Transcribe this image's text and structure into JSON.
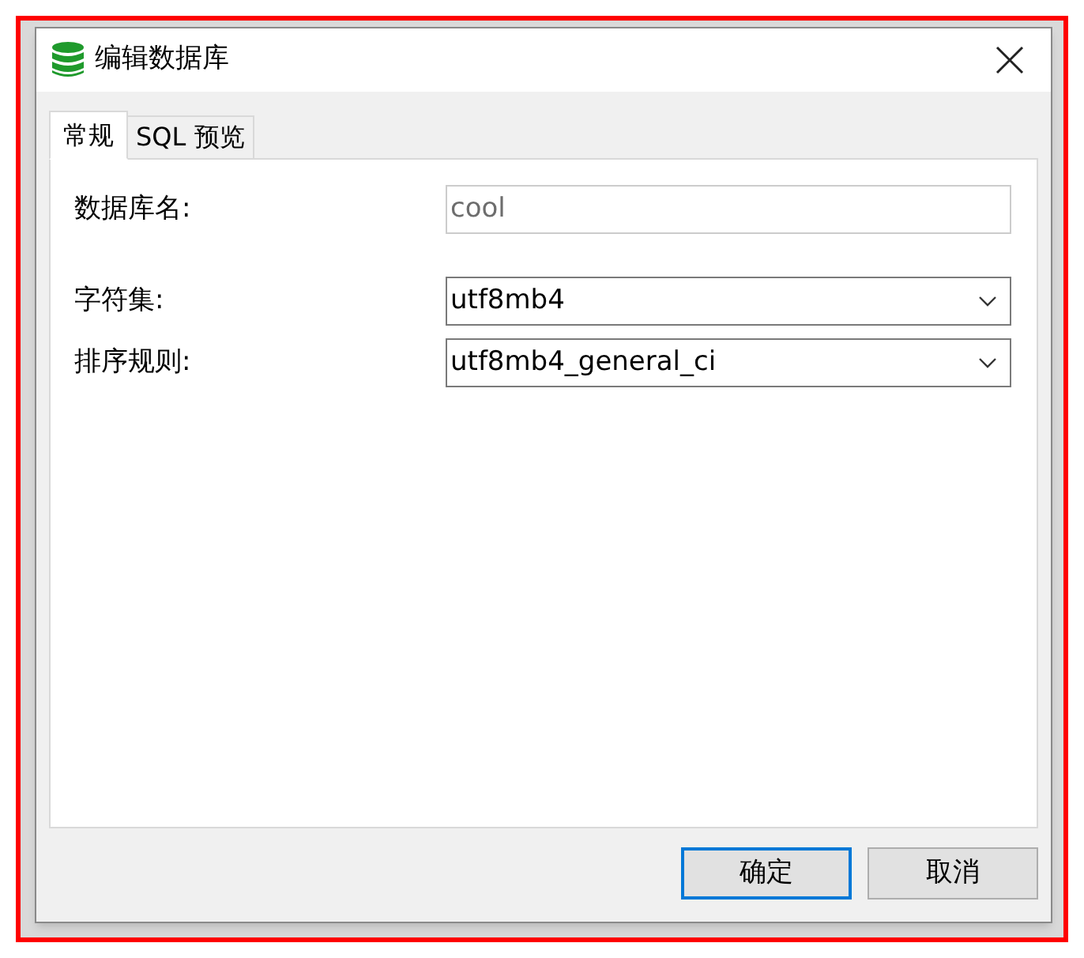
{
  "window": {
    "title": "编辑数据库"
  },
  "tabs": [
    {
      "label": "常规",
      "selected": true
    },
    {
      "label": "SQL 预览",
      "selected": false
    }
  ],
  "fields": [
    {
      "kind": "text",
      "label": "数据库名:",
      "value": "cool",
      "disabled": true
    },
    {
      "kind": "dropdown",
      "label": "字符集:",
      "value": "utf8mb4",
      "disabled": false
    },
    {
      "kind": "dropdown",
      "label": "排序规则:",
      "value": "utf8mb4_general_ci",
      "disabled": false
    }
  ],
  "buttons": [
    {
      "label": "确定",
      "default": true
    },
    {
      "label": "取消",
      "default": false
    }
  ]
}
